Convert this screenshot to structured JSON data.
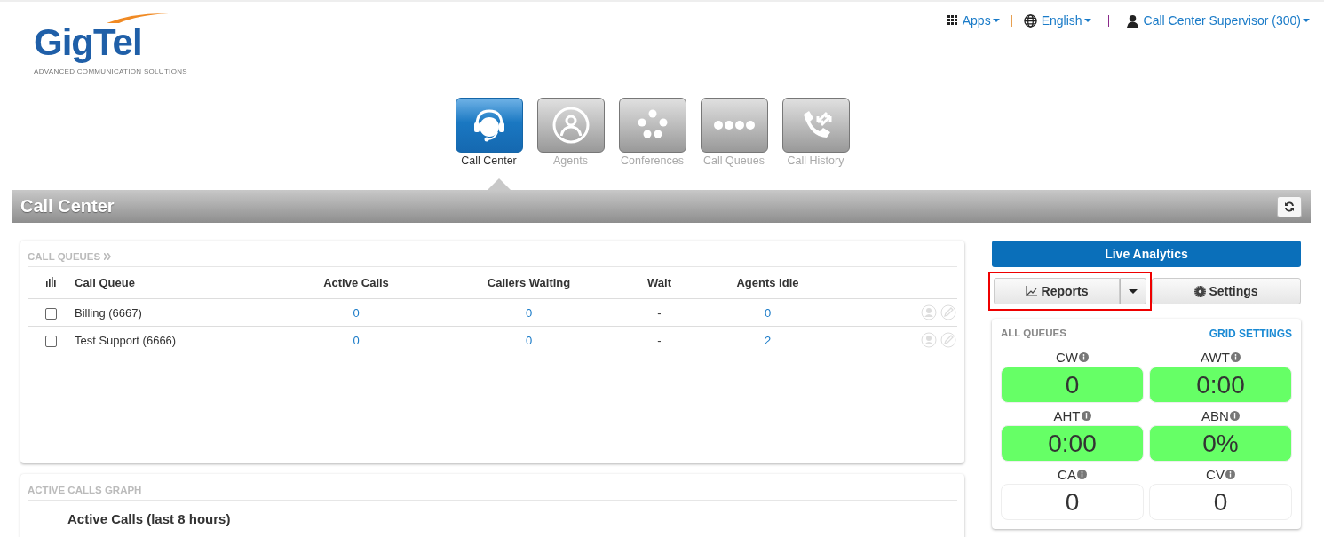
{
  "logo": {
    "name": "GigTel",
    "tagline": "ADVANCED COMMUNICATION SOLUTIONS"
  },
  "top_menu": [
    {
      "kind": "apps",
      "label": "Apps"
    },
    {
      "kind": "language",
      "label": "English"
    },
    {
      "kind": "user",
      "label": "Call Center Supervisor (300)"
    }
  ],
  "nav": [
    {
      "kind": "headset",
      "label": "Call Center",
      "selected": true
    },
    {
      "kind": "agents",
      "label": "Agents",
      "selected": false
    },
    {
      "kind": "conference",
      "label": "Conferences",
      "selected": false
    },
    {
      "kind": "queues",
      "label": "Call Queues",
      "selected": false
    },
    {
      "kind": "history",
      "label": "Call History",
      "selected": false
    }
  ],
  "page_title": "Call Center",
  "call_queues": {
    "title": "CALL QUEUES",
    "columns": [
      "Call Queue",
      "Active Calls",
      "Callers Waiting",
      "Wait",
      "Agents Idle"
    ],
    "rows": [
      {
        "checked": false,
        "cells": [
          "Billing (6667)",
          "0",
          "0",
          "-",
          "0"
        ]
      },
      {
        "checked": false,
        "cells": [
          "Test Support (6666)",
          "0",
          "0",
          "-",
          "2"
        ]
      }
    ]
  },
  "graph": {
    "title": "ACTIVE CALLS GRAPH",
    "heading": "Active Calls (last 8 hours)"
  },
  "live_analytics": "Live Analytics",
  "reports": {
    "label": "Reports",
    "highlighted": true
  },
  "settings": "Settings",
  "all_queues": {
    "title": "ALL QUEUES",
    "link": "GRID SETTINGS",
    "metrics": [
      {
        "label": "CW",
        "value": "0",
        "color": "#66ff66"
      },
      {
        "label": "AWT",
        "value": "0:00",
        "color": "#66ff66"
      },
      {
        "label": "AHT",
        "value": "0:00",
        "color": "#66ff66"
      },
      {
        "label": "ABN",
        "value": "0%",
        "color": "#66ff66"
      },
      {
        "label": "CA",
        "value": "0",
        "color": "#ffffff"
      },
      {
        "label": "CV",
        "value": "0",
        "color": "#ffffff"
      }
    ]
  }
}
